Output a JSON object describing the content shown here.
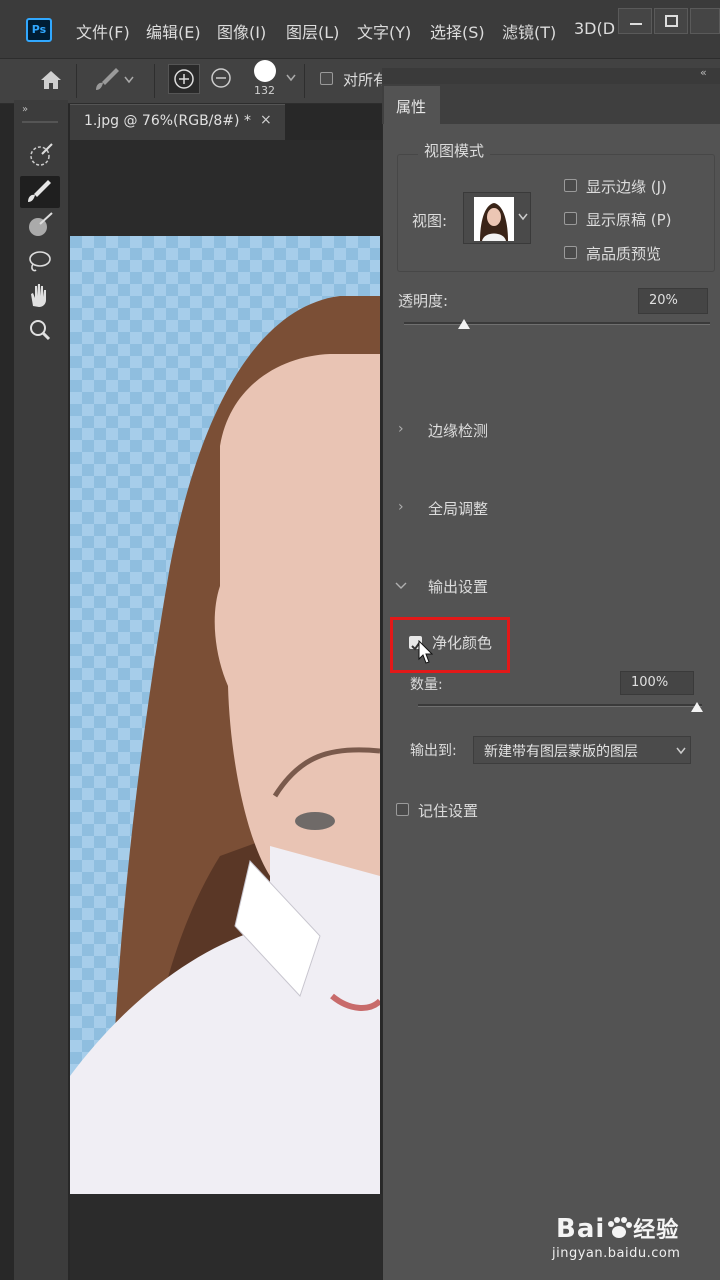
{
  "app": {
    "logo": "Ps"
  },
  "menu": [
    "文件(F)",
    "编辑(E)",
    "图像(I)",
    "图层(L)",
    "文字(Y)",
    "选择(S)",
    "滤镜(T)",
    "3D(D"
  ],
  "options_bar": {
    "brush_size": "132",
    "checkbox_label": "对所有"
  },
  "document": {
    "tab_label": "1.jpg @ 76%(RGB/8#) *",
    "close_glyph": "×"
  },
  "panel": {
    "tab": "属性",
    "view_mode": {
      "group_title": "视图模式",
      "view_label": "视图:",
      "options": [
        "显示边缘 (J)",
        "显示原稿 (P)",
        "高品质预览"
      ]
    },
    "opacity": {
      "label": "透明度:",
      "value": "20%",
      "level": 0.2
    },
    "sections": [
      {
        "label": "边缘检测",
        "expanded": false
      },
      {
        "label": "全局调整",
        "expanded": false
      },
      {
        "label": "输出设置",
        "expanded": true
      }
    ],
    "decontaminate": {
      "label": "净化颜色",
      "checked": true
    },
    "amount": {
      "label": "数量:",
      "value": "100%",
      "level": 1.0
    },
    "output_to": {
      "label": "输出到:",
      "value": "新建带有图层蒙版的图层"
    },
    "remember": {
      "label": "记住设置",
      "checked": false
    }
  },
  "watermark": {
    "brand": "Bai",
    "brand_suffix": "经验",
    "url": "jingyan.baidu.com"
  },
  "colors": {
    "highlight": "#e31919",
    "ps_blue": "#31a8ff",
    "panel_bg": "#535353"
  }
}
